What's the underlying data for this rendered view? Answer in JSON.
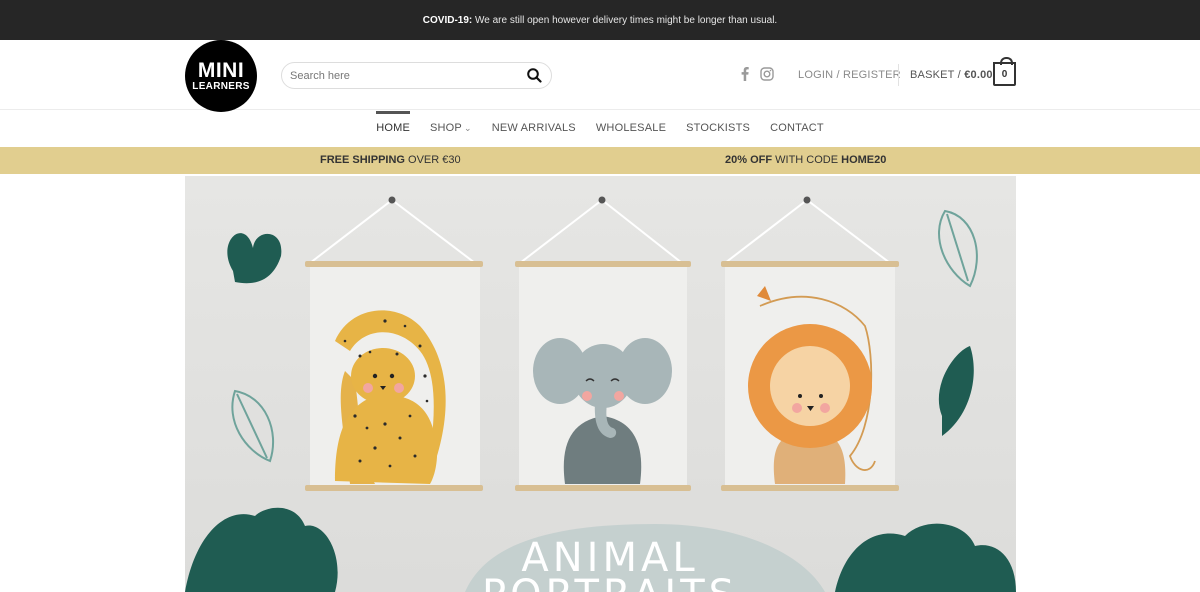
{
  "announcement": {
    "label": "COVID-19:",
    "text": " We are still open however delivery times might be longer than usual."
  },
  "logo": {
    "line1": "MINI",
    "line2": "LEARNERS"
  },
  "search": {
    "placeholder": "Search here"
  },
  "social": {
    "icons": [
      "facebook-icon",
      "instagram-icon"
    ]
  },
  "account": {
    "login_label": "LOGIN / REGISTER"
  },
  "basket": {
    "label": "BASKET / ",
    "amount": "€0.00",
    "count": "0"
  },
  "nav": {
    "items": [
      {
        "label": "HOME",
        "active": true
      },
      {
        "label": "SHOP",
        "has_dropdown": true
      },
      {
        "label": "NEW ARRIVALS"
      },
      {
        "label": "WHOLESALE"
      },
      {
        "label": "STOCKISTS"
      },
      {
        "label": "CONTACT"
      }
    ]
  },
  "promo": {
    "shipping_bold": "FREE SHIPPING",
    "shipping_rest": " OVER €30",
    "discount_bold": "20% OFF",
    "discount_mid": " WITH CODE ",
    "discount_code": "HOME20"
  },
  "hero": {
    "title_line1": "ANIMAL",
    "title_line2": "PORTRAITS"
  },
  "colors": {
    "topbar": "#262626",
    "promo_bar": "#e1ce8f",
    "leaf_green": "#1f5c52",
    "hill": "#c5d0cf"
  }
}
